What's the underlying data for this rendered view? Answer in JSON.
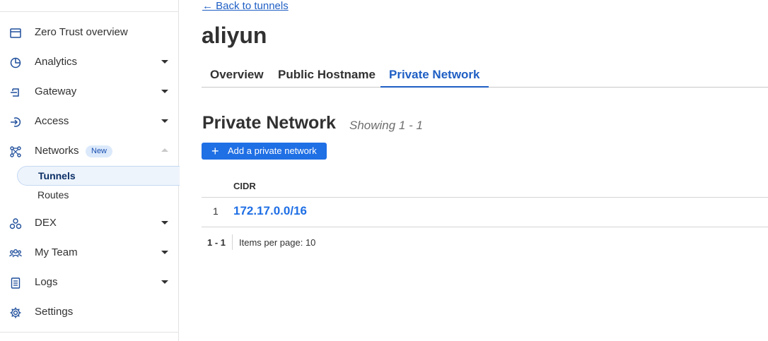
{
  "sidebar": {
    "items": [
      {
        "label": "Zero Trust overview",
        "icon": "browser-window-icon"
      },
      {
        "label": "Analytics",
        "icon": "pie-chart-icon"
      },
      {
        "label": "Gateway",
        "icon": "gateway-icon"
      },
      {
        "label": "Access",
        "icon": "sign-in-icon"
      },
      {
        "label": "Networks",
        "icon": "network-icon",
        "badge": "New"
      },
      {
        "label": "DEX",
        "icon": "dex-icon"
      },
      {
        "label": "My Team",
        "icon": "team-icon"
      },
      {
        "label": "Logs",
        "icon": "logs-icon"
      },
      {
        "label": "Settings",
        "icon": "gear-icon"
      }
    ],
    "networks_sub": [
      {
        "label": "Tunnels",
        "active": true
      },
      {
        "label": "Routes",
        "active": false
      }
    ]
  },
  "main": {
    "back_link": "← Back to tunnels",
    "title": "aliyun",
    "tabs": [
      {
        "label": "Overview",
        "active": false
      },
      {
        "label": "Public Hostname",
        "active": false
      },
      {
        "label": "Private Network",
        "active": true
      }
    ],
    "section_title": "Private Network",
    "section_subtitle": "Showing 1 - 1",
    "add_button": "Add a private network",
    "table": {
      "columns": [
        "CIDR"
      ],
      "rows": [
        {
          "index": "1",
          "cidr": "172.17.0.0/16"
        }
      ]
    },
    "pager": {
      "range": "1 - 1",
      "items_per_page": "Items per page: 10"
    }
  },
  "colors": {
    "accent": "#1f6fe5",
    "link": "#1f5fc4",
    "badge_bg": "#dbe9fb"
  }
}
